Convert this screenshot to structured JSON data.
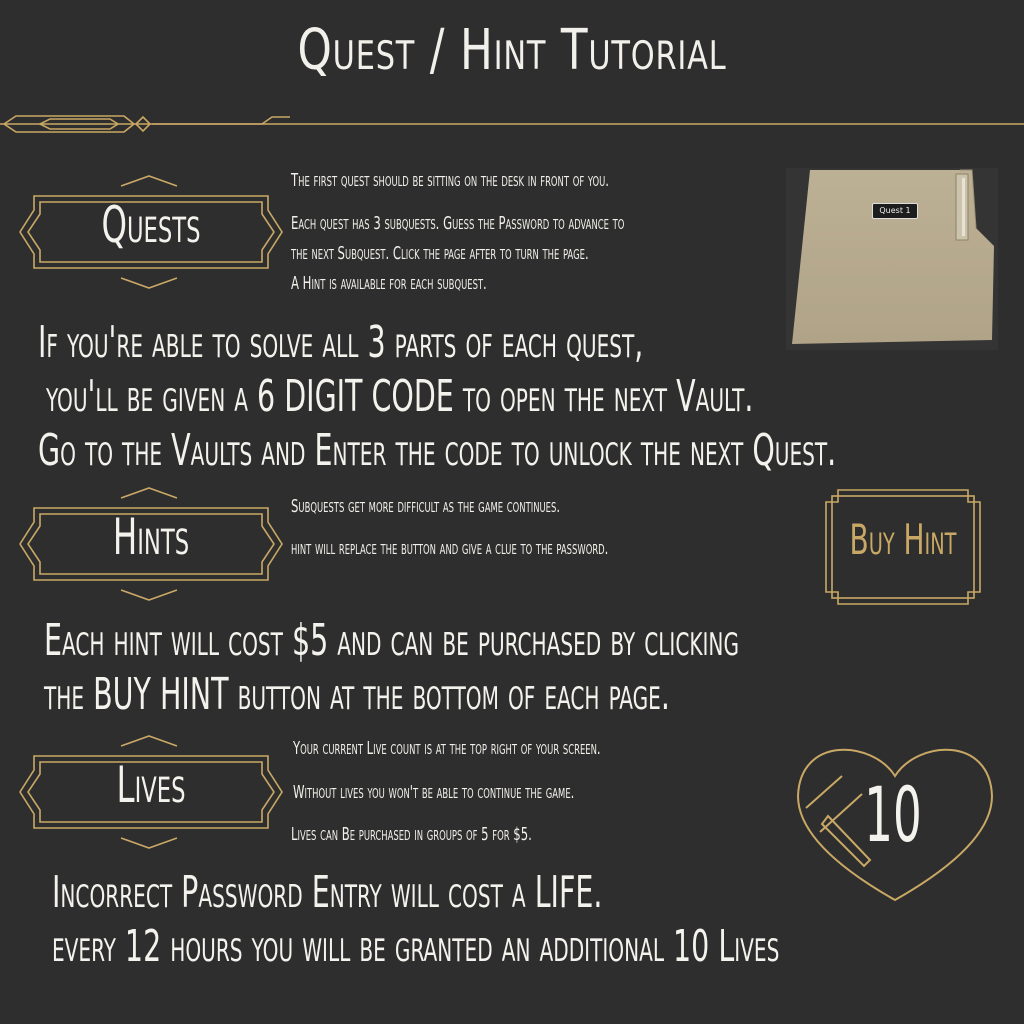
{
  "title": "Quest / Hint Tutorial",
  "colors": {
    "background": "#2e2e2e",
    "gold": "#c9a865",
    "text": "#f2f0ea",
    "folder": "#b9ac91"
  },
  "sections": {
    "quests": {
      "label": "Quests",
      "info": [
        "The first quest should be sitting on the desk in front of you.",
        "Each quest has 3 subquests. Guess the Password to advance to",
        "the next Subquest. Click the page after to turn the page.",
        "A Hint is available for each subquest."
      ],
      "folder_label": "Quest 1",
      "body": [
        "If you're able to solve all 3 parts of each quest,",
        "you'll be given a 6 DIGIT CODE to open the next Vault.",
        "Go to the Vaults and Enter the code to unlock the next Quest."
      ]
    },
    "hints": {
      "label": "Hints",
      "info": [
        "Subquests get more difficult as the game continues.",
        "hint will replace the button and give a clue to the password."
      ],
      "buy_button": "Buy Hint",
      "body": [
        "Each hint will cost $5 and can be purchased by clicking",
        "the BUY HINT button at the bottom of each page."
      ]
    },
    "lives": {
      "label": "Lives",
      "info": [
        "Your current Live count is at the top right of your screen.",
        "Without lives you won't be able to continue the game.",
        "Lives can Be purchased in groups of 5 for $5."
      ],
      "count": "10",
      "body": [
        "Incorrect Password Entry will cost a LIFE.",
        "every 12 hours you will be granted an additional 10 Lives"
      ]
    }
  }
}
